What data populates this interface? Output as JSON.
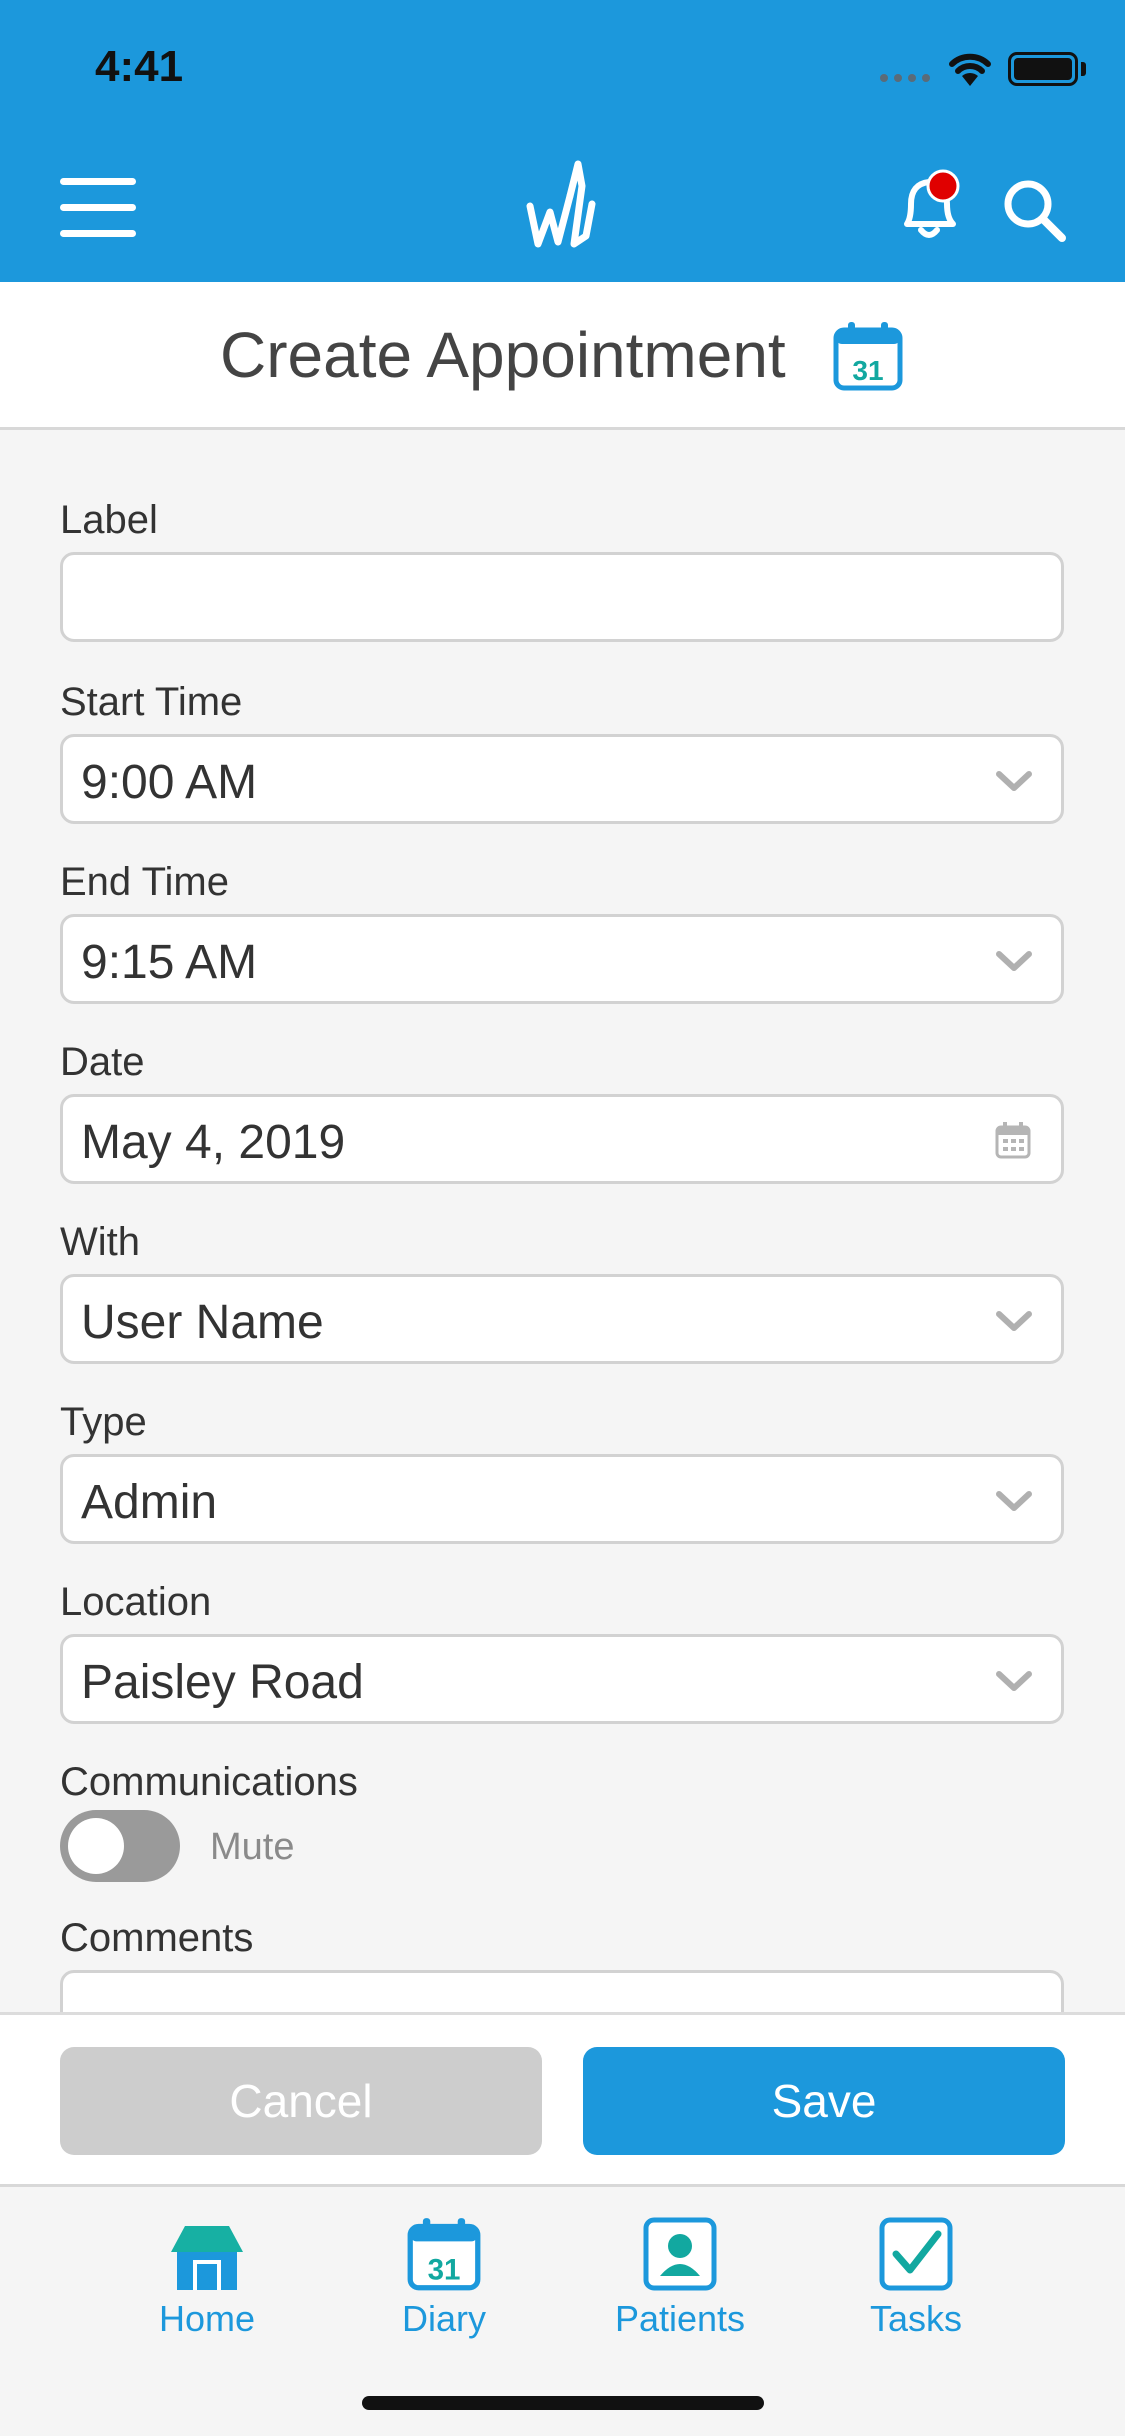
{
  "status_bar": {
    "time": "4:41"
  },
  "header": {
    "menu_icon": "hamburger-menu-icon",
    "logo_icon": "app-logo-icon",
    "notification_icon": "bell-icon",
    "search_icon": "search-icon",
    "brand_color": "#1c98dc",
    "notification_dot_color": "#e00000"
  },
  "page": {
    "title": "Create Appointment",
    "title_icon": "calendar-icon",
    "title_icon_day": "31"
  },
  "form": {
    "label": {
      "label": "Label",
      "value": ""
    },
    "start_time": {
      "label": "Start Time",
      "value": "9:00 AM"
    },
    "end_time": {
      "label": "End Time",
      "value": "9:15 AM"
    },
    "date": {
      "label": "Date",
      "value": "May 4, 2019"
    },
    "with": {
      "label": "With",
      "value": "User Name"
    },
    "type": {
      "label": "Type",
      "value": "Admin"
    },
    "location": {
      "label": "Location",
      "value": "Paisley Road"
    },
    "communications": {
      "label": "Communications",
      "toggle_label": "Mute",
      "enabled": false
    },
    "comments": {
      "label": "Comments",
      "value": ""
    }
  },
  "actions": {
    "cancel_label": "Cancel",
    "save_label": "Save"
  },
  "tabs": [
    {
      "label": "Home",
      "icon": "home-icon"
    },
    {
      "label": "Diary",
      "icon": "calendar-icon",
      "day": "31"
    },
    {
      "label": "Patients",
      "icon": "patient-icon"
    },
    {
      "label": "Tasks",
      "icon": "checkbox-icon"
    }
  ]
}
